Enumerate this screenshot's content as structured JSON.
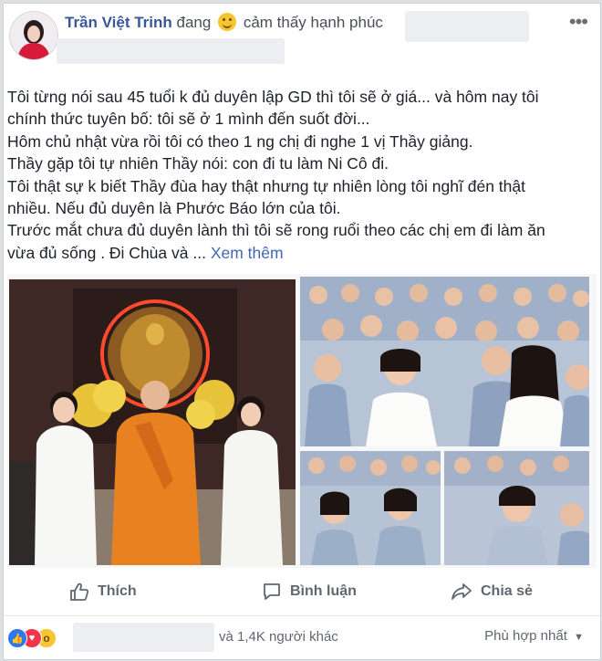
{
  "post": {
    "author": "Trần Việt Trinh",
    "feeling_prefix": "đang",
    "feeling_text": "cảm thấy hạnh phúc",
    "more_icon": "three-dots-icon",
    "lines": [
      "Tôi từng nói sau 45 tuổi k đủ duyên lập GD thì tôi sẽ ở giá... và hôm nay tôi",
      "chính thức tuyên bố: tôi sẽ ở 1 mình đến suốt đời...",
      "Hôm chủ nhật vừa rồi tôi có theo 1 ng chị đi nghe 1 vị Thầy giảng.",
      "Thầy gặp tôi tự nhiên Thầy nói: con đi tu làm Ni Cô đi.",
      "Tôi thật sự k biết Thầy đùa hay thật nhưng tự nhiên lòng tôi nghĩ đén thật",
      "nhiều. Nếu đủ duyên là Phước Báo lớn của tôi.",
      "Trước mắt chưa đủ duyên lành thì tôi sẽ rong ruổi theo các chị em đi làm ăn"
    ],
    "last_line": "vừa đủ sống . Đi Chùa và ...",
    "see_more": "Xem thêm"
  },
  "actions": {
    "like": "Thích",
    "comment": "Bình luận",
    "share": "Chia sẻ"
  },
  "reactions": {
    "icons": [
      "like-icon",
      "love-icon",
      "wow-icon"
    ],
    "others_text": "và 1,4K người khác",
    "sort_label": "Phù hợp nhất"
  },
  "colors": {
    "link": "#365899",
    "see_more": "#4267b2",
    "like": "#2f77f2",
    "love": "#f0364b",
    "wow": "#f7c531",
    "monk_robe": "#e8811f"
  }
}
